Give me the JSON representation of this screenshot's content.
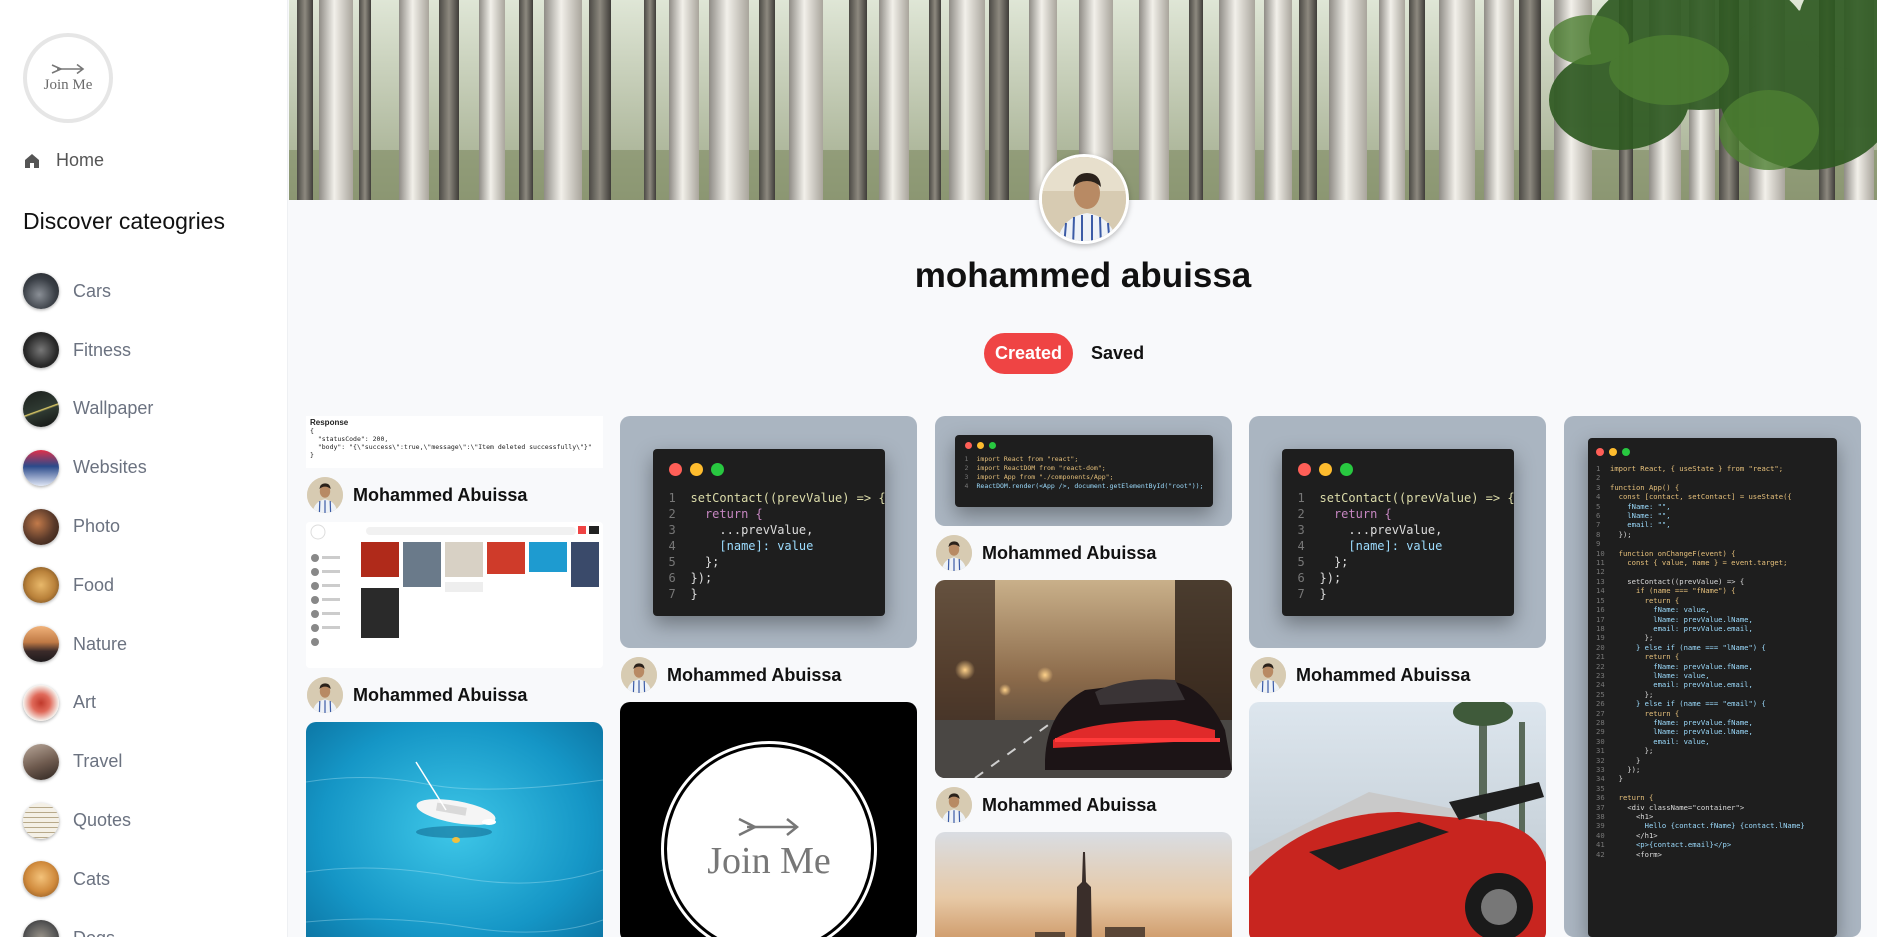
{
  "logo": {
    "text": "Join Me"
  },
  "nav": {
    "home_label": "Home"
  },
  "discover": {
    "title": "Discover cateogries",
    "categories": [
      {
        "label": "Cars",
        "color": "#3a3f46"
      },
      {
        "label": "Fitness",
        "color": "#2a2a2a"
      },
      {
        "label": "Wallpaper",
        "color": "#2f3a32"
      },
      {
        "label": "Websites",
        "color": "#2b4a8a"
      },
      {
        "label": "Photo",
        "color": "#5a3a2a"
      },
      {
        "label": "Food",
        "color": "#b9813a"
      },
      {
        "label": "Nature",
        "color": "#c07a45"
      },
      {
        "label": "Art",
        "color": "#c0392b"
      },
      {
        "label": "Travel",
        "color": "#6e5a4e"
      },
      {
        "label": "Quotes",
        "color": "#e9e4d8"
      },
      {
        "label": "Cats",
        "color": "#d08a3c"
      },
      {
        "label": "Dogs",
        "color": "#555555"
      }
    ]
  },
  "profile": {
    "name": "mohammed abuissa"
  },
  "tabs": {
    "created": "Created",
    "saved": "Saved"
  },
  "pins": {
    "author": "Mohammed Abuissa",
    "response": {
      "title": "Response",
      "line1": "{",
      "line2": "  \"statusCode\": 200,",
      "line3": "  \"body\": \"{\\\"success\\\":true,\\\"message\\\":\\\"Item deleted successfully\\\"}\"",
      "line4": "}"
    },
    "joinme_text": "Join Me",
    "code_small": {
      "l1": "import React from \"react\";",
      "l2": "import ReactDOM from \"react-dom\";",
      "l3": "import App from \"./components/App\";",
      "l4": "ReactDOM.render(<App />, document.getElementById(\"root\"));"
    },
    "code_set": {
      "l1": "setContact((prevValue) => {",
      "l2": "  return {",
      "l3": "    ...prevValue,",
      "l4": "    [name]: value",
      "l5": "  };",
      "l6": "});",
      "l7": "}"
    },
    "code_long": [
      "import React, { useState } from \"react\";",
      "",
      "function App() {",
      "  const [contact, setContact] = useState({",
      "    fName: \"\",",
      "    lName: \"\",",
      "    email: \"\",",
      "  });",
      "",
      "  function onChangeF(event) {",
      "    const { value, name } = event.target;",
      "",
      "    setContact((prevValue) => {",
      "      if (name === \"fName\") {",
      "        return {",
      "          fName: value,",
      "          lName: prevValue.lName,",
      "          email: prevValue.email,",
      "        };",
      "      } else if (name === \"lName\") {",
      "        return {",
      "          fName: prevValue.fName,",
      "          lName: value,",
      "          email: prevValue.email,",
      "        };",
      "      } else if (name === \"email\") {",
      "        return {",
      "          fName: prevValue.fName,",
      "          lName: prevValue.lName,",
      "          email: value,",
      "        };",
      "      }",
      "    });",
      "  }",
      "",
      "  return {",
      "    <div className=\"container\">",
      "      <h1>",
      "        Hello {contact.fName} {contact.lName}",
      "      </h1>",
      "      <p>{contact.email}</p>",
      "      <form>"
    ]
  },
  "colors": {
    "accent": "#ef4444"
  }
}
